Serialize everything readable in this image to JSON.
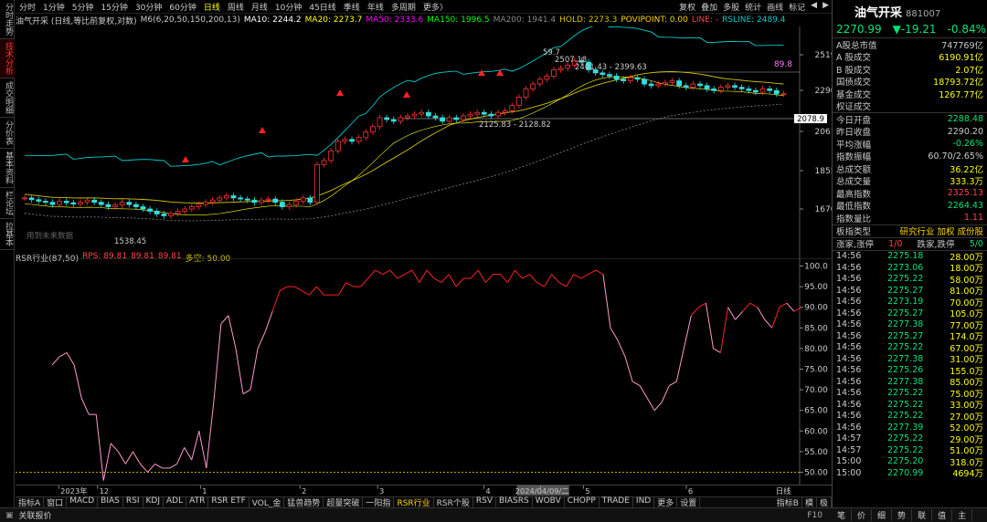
{
  "vertical_tabs": [
    "分时走势",
    "技术分析",
    "成交明细",
    "分价表",
    "基本资料",
    "栏论坛",
    "拉基本"
  ],
  "period_tabs": [
    "分时",
    "1分钟",
    "5分钟",
    "15分钟",
    "30分钟",
    "60分钟",
    "日线",
    "周线",
    "月线",
    "10分钟",
    "45日线",
    "季线",
    "年线",
    "多周期",
    "更多〉"
  ],
  "active_period": "日线",
  "toolbar": [
    "复权",
    "叠加",
    "多股",
    "统计",
    "画线",
    "标记",
    "◀",
    "▶"
  ],
  "legend": {
    "name": "油气开采 (日线,等比前复权,对数)",
    "ma_param": "M6(6,20,50,150,200,13)",
    "ma10": "MA10: 2244.2",
    "ma20": "MA20: 2273.7",
    "ma50": "MA50: 2333.6",
    "ma150": "MA150: 1996.5",
    "ma200": "MA200: 1941.4",
    "hold": "HOLD: 2273.3",
    "povi": "POVIPOINT: 0.00",
    "line": "LINE: -",
    "rsline": "RSLINE: 2489.4",
    "colors": {
      "ma10": "#ffffff",
      "ma20": "#ffff00",
      "ma50": "#ff00ff",
      "ma150": "#00ff00",
      "ma200": "#888888",
      "hold": "#d4c400",
      "povi": "#ffd700",
      "rsline": "#00cccc"
    }
  },
  "main_chart": {
    "y_ticks": [
      "2519",
      "2290",
      "2061",
      "1855",
      "1670"
    ],
    "labels": {
      "high_label": "59.7",
      "high_price": "2507.18",
      "range1": "2401.43 - 2399.63",
      "range2": "2125.83 - 2128.82",
      "low_price": "1538.45",
      "rsr_now": "89.8",
      "cur_price_tag": "2078.9",
      "watermark": "用到未来数据"
    }
  },
  "rsr_legend": {
    "name": "RSR行业(87,50)",
    "rps": "RPS: 89.81",
    "v1": "89.81",
    "v2": "89.81",
    "bull": "多空: 50.00"
  },
  "rsr_chart": {
    "type": "line",
    "y_ticks": [
      "100.0",
      "95.00",
      "90.00",
      "85.00",
      "80.00",
      "75.00",
      "70.00",
      "65.00",
      "60.00",
      "55.00",
      "50.00"
    ],
    "ylim": [
      47,
      101
    ],
    "x": [
      "2023年",
      "12",
      "1",
      "2",
      "3",
      "4",
      "5",
      "6"
    ],
    "series": [
      {
        "values": [
          76,
          78,
          79,
          76,
          68,
          64,
          64,
          48,
          57,
          55,
          52,
          55,
          52,
          50,
          52,
          51,
          51,
          52,
          56,
          53,
          60,
          51,
          67,
          86,
          88,
          80,
          69,
          70,
          80,
          84,
          89,
          94,
          95,
          95,
          94,
          93,
          95,
          93,
          93,
          93,
          96,
          95,
          95,
          97,
          99,
          98,
          99,
          97,
          98,
          99,
          96,
          99,
          97,
          96,
          98,
          95,
          97,
          97,
          99,
          96,
          98,
          98,
          96,
          99,
          97,
          98,
          96,
          95,
          98,
          96,
          95,
          98,
          97,
          98,
          99,
          98,
          85,
          82,
          78,
          72,
          71,
          68,
          65,
          67,
          71,
          72,
          80,
          88,
          90,
          91,
          80,
          79,
          90,
          87,
          89,
          91,
          90,
          87,
          85,
          90,
          91,
          89,
          90
        ]
      }
    ],
    "ref_line": 50
  },
  "x_axis": {
    "labels": [
      "2023年",
      "12",
      "1",
      "2",
      "3",
      "4",
      "2024/04/09/二",
      "5",
      "6"
    ],
    "right": "日线"
  },
  "indicator_tabs": [
    "指标A",
    "窗口",
    "MACD",
    "BIAS",
    "RSI",
    "KDJ",
    "ADL",
    "ATR",
    "RSR ETF",
    "VOL_金",
    "猛兽趋势",
    "超量突破",
    "一阳指",
    "RSR行业",
    "RSR个股",
    "RSV",
    "BIASRS",
    "WOBV",
    "CHOPP",
    "TRADE",
    "IND",
    "更多",
    "设置"
  ],
  "active_indicator": "RSR行业",
  "indicator_right": [
    "指标B",
    "模",
    "极"
  ],
  "status_left": "关联报价",
  "status_right": "F10",
  "panel": {
    "name": "油气开采",
    "code": "881007",
    "price": "2270.99",
    "change": "▼-19.21",
    "pct": "-0.84%",
    "stats1": [
      {
        "k": "A股总市值",
        "v": "747769亿",
        "c": "#ccc"
      },
      {
        "k": "A 股成交",
        "v": "6190.91亿",
        "c": "#ffff00"
      },
      {
        "k": "B 股成交",
        "v": "2.07亿",
        "c": "#ffff00"
      },
      {
        "k": "国债成交",
        "v": "18793.72亿",
        "c": "#ffff00"
      },
      {
        "k": "基金成交",
        "v": "1267.77亿",
        "c": "#ffff00"
      },
      {
        "k": "权证成交",
        "v": "",
        "c": "#ffff00"
      }
    ],
    "stats2": [
      {
        "k": "今日开盘",
        "v": "2288.48",
        "c": "#00e676"
      },
      {
        "k": "昨日收盘",
        "v": "2290.20",
        "c": "#ccc"
      },
      {
        "k": "平均涨幅",
        "v": "-0.26%",
        "c": "#00e676"
      },
      {
        "k": "指数振幅",
        "v": "60.70/2.65%",
        "c": "#ccc"
      },
      {
        "k": "总成交额",
        "v": "36.22亿",
        "c": "#ffff00"
      },
      {
        "k": "总成交量",
        "v": "333.3万",
        "c": "#ffff00"
      },
      {
        "k": "最高指数",
        "v": "2325.13",
        "c": "#ff4444"
      },
      {
        "k": "最低指数",
        "v": "2264.43",
        "c": "#00e676"
      },
      {
        "k": "指数量比",
        "v": "1.11",
        "c": "#ff4444"
      }
    ],
    "board_type_k": "板指类型",
    "board_type_v": "研究行业 加权 成份股",
    "limit_up_k": "涨家,涨停",
    "limit_up_v": "1/0",
    "limit_down_k": "跌家,跌停",
    "limit_down_v": "5/0",
    "trades": [
      {
        "t": "14:56",
        "p": "2275.18",
        "v": "28.00万"
      },
      {
        "t": "14:56",
        "p": "2273.06",
        "v": "18.00万"
      },
      {
        "t": "14:56",
        "p": "2275.22",
        "v": "58.00万"
      },
      {
        "t": "14:56",
        "p": "2275.27",
        "v": "81.00万"
      },
      {
        "t": "14:56",
        "p": "2273.19",
        "v": "70.00万"
      },
      {
        "t": "14:56",
        "p": "2275.27",
        "v": "105.0万"
      },
      {
        "t": "14:56",
        "p": "2277.38",
        "v": "77.00万"
      },
      {
        "t": "14:56",
        "p": "2275.27",
        "v": "174.0万"
      },
      {
        "t": "14:56",
        "p": "2275.22",
        "v": "67.00万"
      },
      {
        "t": "14:56",
        "p": "2277.38",
        "v": "31.00万"
      },
      {
        "t": "14:56",
        "p": "2275.26",
        "v": "155.0万"
      },
      {
        "t": "14:56",
        "p": "2277.38",
        "v": "85.00万"
      },
      {
        "t": "14:56",
        "p": "2275.22",
        "v": "75.00万"
      },
      {
        "t": "14:56",
        "p": "2275.22",
        "v": "33.00万"
      },
      {
        "t": "14:56",
        "p": "2275.22",
        "v": "27.00万"
      },
      {
        "t": "14:56",
        "p": "2277.39",
        "v": "52.00万"
      },
      {
        "t": "14:57",
        "p": "2275.22",
        "v": "29.00万"
      },
      {
        "t": "14:57",
        "p": "2275.22",
        "v": "51.00万"
      },
      {
        "t": "15:00",
        "p": "2275.20",
        "v": "318.0万"
      },
      {
        "t": "15:00",
        "p": "2270.99",
        "v": "4694万"
      }
    ],
    "bottom_tabs": [
      "笔",
      "价",
      "细",
      "势",
      "联",
      "值",
      "主"
    ]
  }
}
